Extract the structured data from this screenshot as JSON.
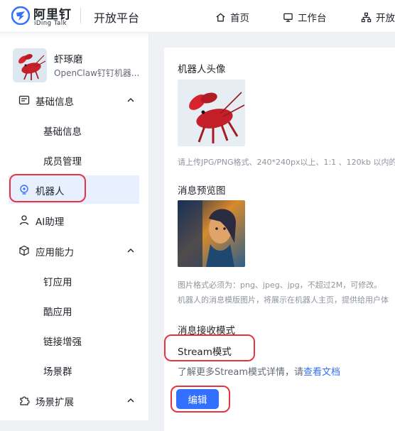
{
  "header": {
    "logo_cn": "阿里钉",
    "logo_en": "iDing Talk",
    "platform_title": "开放平台",
    "nav": [
      {
        "label": "首页",
        "icon": "home-icon"
      },
      {
        "label": "工作台",
        "icon": "monitor-icon"
      },
      {
        "label": "开放",
        "icon": "org-tree-icon"
      }
    ]
  },
  "sidebar": {
    "app": {
      "name": "虾琢磨",
      "subtitle": "OpenClaw钉钉机器..."
    },
    "items": [
      {
        "label": "基础信息",
        "icon": "info-card-icon"
      },
      {
        "label": "机器人",
        "icon": "robot-icon"
      },
      {
        "label": "AI助理",
        "icon": "person-icon"
      },
      {
        "label": "应用能力",
        "icon": "cube-icon"
      },
      {
        "label": "场景扩展",
        "icon": "puzzle-icon"
      }
    ],
    "sub_items": {
      "basic": [
        "基础信息",
        "成员管理"
      ],
      "capability": [
        "钉应用",
        "酷应用",
        "链接增强",
        "场景群"
      ]
    }
  },
  "main": {
    "avatar_label": "机器人头像",
    "avatar_hint": "请上传JPG/PNG格式、240*240px以上、1:1 、120kb 以内的",
    "preview_label": "消息预览图",
    "preview_hint1": "图片格式必须为：png、jpeg、jpg，不超过2M，可修改。",
    "preview_hint2": "机器人的消息模版图片，将展示在机器人主页，提供给用户体",
    "receive_mode_label": "消息接收模式",
    "receive_mode_value": "Stream模式",
    "learn_more_text": "了解更多Stream模式详情，请",
    "learn_more_link": "查看文档",
    "edit_button": "编辑"
  },
  "colors": {
    "accent": "#3370ff",
    "highlight_red": "#e8343f",
    "active_bg": "#e8efff"
  }
}
